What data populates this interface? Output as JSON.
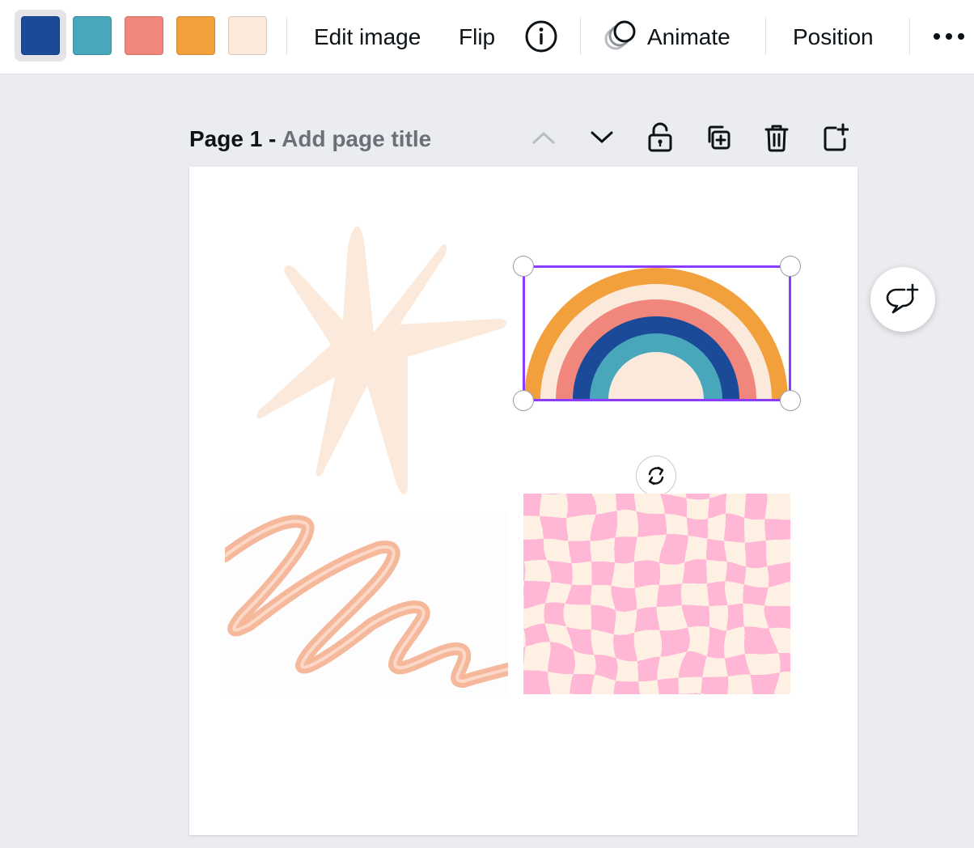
{
  "toolbar": {
    "swatches": [
      {
        "name": "dark-blue",
        "color": "#1b4a98"
      },
      {
        "name": "teal",
        "color": "#48a7bb"
      },
      {
        "name": "salmon",
        "color": "#f1867c"
      },
      {
        "name": "orange",
        "color": "#f1a03c"
      },
      {
        "name": "cream",
        "color": "#fbeadb"
      }
    ],
    "edit_image_label": "Edit image",
    "flip_label": "Flip",
    "info_icon": "info-icon",
    "animate_label": "Animate",
    "position_label": "Position",
    "more_icon": "more-icon"
  },
  "page": {
    "number_label": "Page 1",
    "separator": " - ",
    "title_placeholder": "Add page title"
  },
  "canvas": {
    "background": "#ffffff",
    "selection_color": "#8b3dff",
    "elements": {
      "starburst_color": "#fbeadb",
      "rainbow_colors": [
        "#f1a03c",
        "#fbeadb",
        "#f1867c",
        "#1b4a98",
        "#48a7bb",
        "#fbeadb"
      ],
      "scribble_color": "#f6b89b",
      "checker_colors": [
        "#ffb7d5",
        "#fff0e4"
      ]
    }
  }
}
